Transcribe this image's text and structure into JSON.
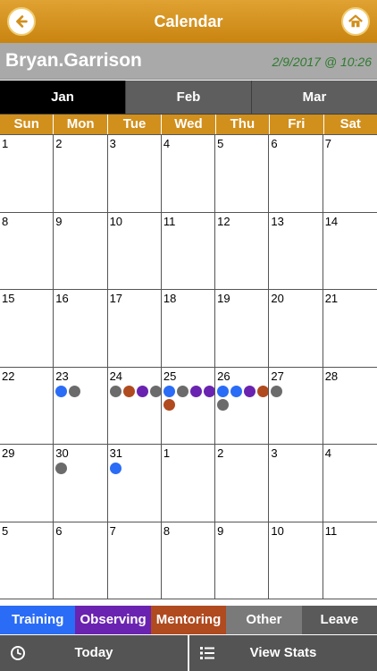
{
  "header": {
    "title": "Calendar",
    "back_icon": "arrow-left-icon",
    "home_icon": "home-icon"
  },
  "user": {
    "name": "Bryan.Garrison",
    "timestamp": "2/9/2017 @ 10:26"
  },
  "months": [
    {
      "label": "Jan",
      "active": true
    },
    {
      "label": "Feb",
      "active": false
    },
    {
      "label": "Mar",
      "active": false
    }
  ],
  "weekdays": [
    "Sun",
    "Mon",
    "Tue",
    "Wed",
    "Thu",
    "Fri",
    "Sat"
  ],
  "colors": {
    "training": "#2a6cf6",
    "observing": "#6a23b0",
    "mentoring": "#b04a1f",
    "other": "#6b6b6b",
    "leave": "#5a5a5a"
  },
  "calendar": {
    "days": [
      {
        "day": "1",
        "events": []
      },
      {
        "day": "2",
        "events": []
      },
      {
        "day": "3",
        "events": []
      },
      {
        "day": "4",
        "events": []
      },
      {
        "day": "5",
        "events": []
      },
      {
        "day": "6",
        "events": []
      },
      {
        "day": "7",
        "events": []
      },
      {
        "day": "8",
        "events": []
      },
      {
        "day": "9",
        "events": []
      },
      {
        "day": "10",
        "events": []
      },
      {
        "day": "11",
        "events": []
      },
      {
        "day": "12",
        "events": []
      },
      {
        "day": "13",
        "events": []
      },
      {
        "day": "14",
        "events": []
      },
      {
        "day": "15",
        "events": []
      },
      {
        "day": "16",
        "events": []
      },
      {
        "day": "17",
        "events": []
      },
      {
        "day": "18",
        "events": []
      },
      {
        "day": "19",
        "events": []
      },
      {
        "day": "20",
        "events": []
      },
      {
        "day": "21",
        "events": []
      },
      {
        "day": "22",
        "events": []
      },
      {
        "day": "23",
        "events": [
          "training",
          "other"
        ]
      },
      {
        "day": "24",
        "events": [
          "other",
          "mentoring",
          "observing",
          "other"
        ]
      },
      {
        "day": "25",
        "events": [
          "training",
          "other",
          "observing",
          "observing",
          "mentoring"
        ]
      },
      {
        "day": "26",
        "events": [
          "training",
          "training",
          "observing",
          "mentoring",
          "other"
        ]
      },
      {
        "day": "27",
        "events": [
          "other"
        ]
      },
      {
        "day": "28",
        "events": []
      },
      {
        "day": "29",
        "events": []
      },
      {
        "day": "30",
        "events": [
          "other"
        ]
      },
      {
        "day": "31",
        "events": [
          "training"
        ]
      },
      {
        "day": "1",
        "events": []
      },
      {
        "day": "2",
        "events": []
      },
      {
        "day": "3",
        "events": []
      },
      {
        "day": "4",
        "events": []
      },
      {
        "day": "5",
        "events": []
      },
      {
        "day": "6",
        "events": []
      },
      {
        "day": "7",
        "events": []
      },
      {
        "day": "8",
        "events": []
      },
      {
        "day": "9",
        "events": []
      },
      {
        "day": "10",
        "events": []
      },
      {
        "day": "11",
        "events": []
      }
    ]
  },
  "legend": [
    {
      "key": "training",
      "label": "Training",
      "bg": "#2a6cf6"
    },
    {
      "key": "observing",
      "label": "Observing",
      "bg": "#6a23b0"
    },
    {
      "key": "mentoring",
      "label": "Mentoring",
      "bg": "#b04a1f"
    },
    {
      "key": "other",
      "label": "Other",
      "bg": "#7a7a7a"
    },
    {
      "key": "leave",
      "label": "Leave",
      "bg": "#5a5a5a"
    }
  ],
  "footer": {
    "today_label": "Today",
    "today_icon": "clock-icon",
    "stats_label": "View Stats",
    "stats_icon": "list-icon"
  }
}
